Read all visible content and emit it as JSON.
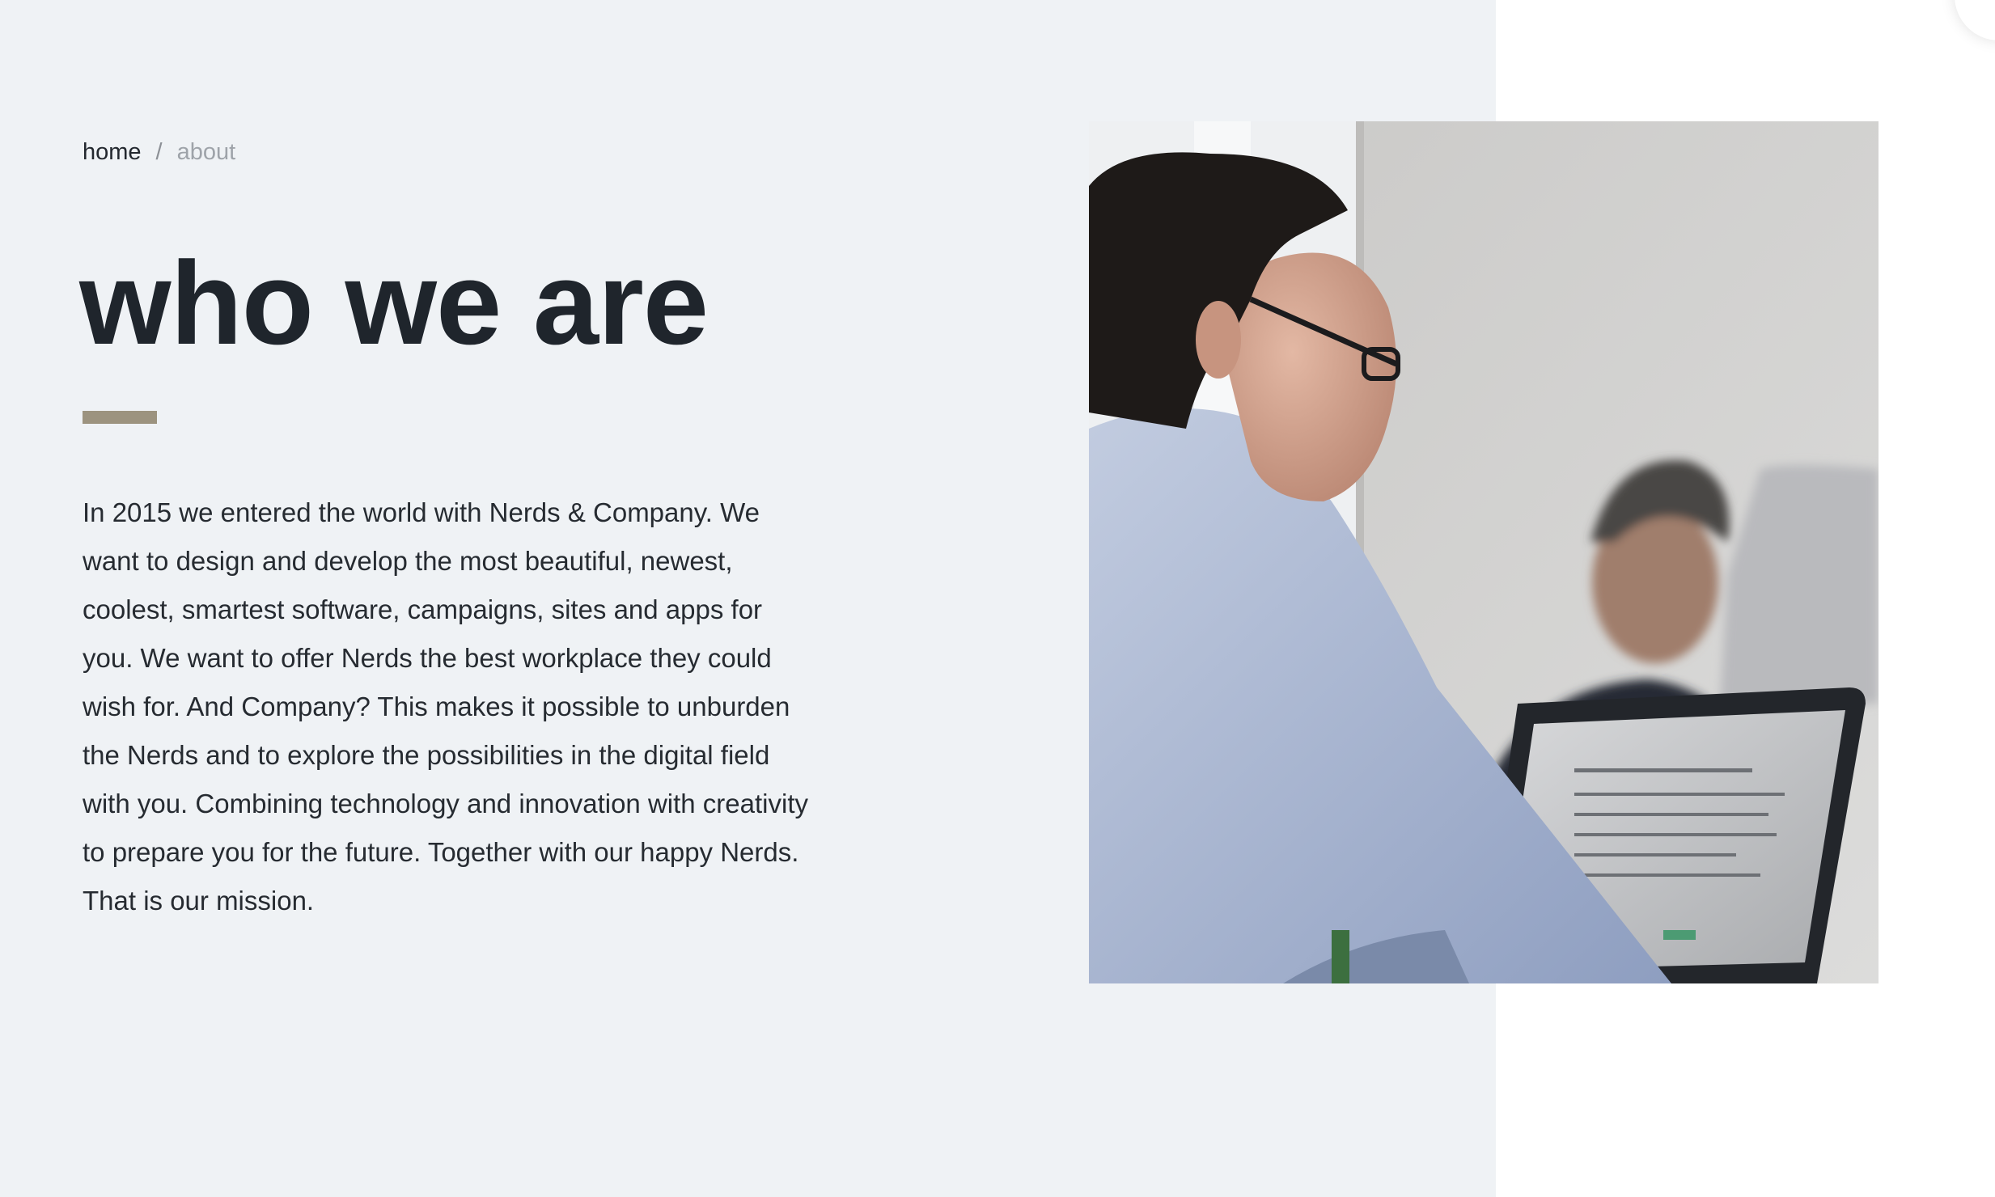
{
  "breadcrumb": {
    "home": "home",
    "separator": "/",
    "current": "about"
  },
  "hero": {
    "title": "who we are",
    "body": "In 2015 we entered the world with Nerds & Company. We want to design and develop the most beautiful, newest, coolest, smartest software, campaigns, sites and apps for you. We want to offer Nerds the best workplace they could wish for. And Company? This makes it possible to unburden the Nerds and to explore the possibilities in the digital field with you. Combining technology and innovation with creativity to prepare you for the future. Together with our happy Nerds. That is our mission."
  },
  "colors": {
    "panel_background": "#eff2f5",
    "title": "#1f252c",
    "accent_bar": "#9c937f",
    "breadcrumb_muted": "#9ea3a9"
  },
  "photo": {
    "icon": "team-photo"
  }
}
